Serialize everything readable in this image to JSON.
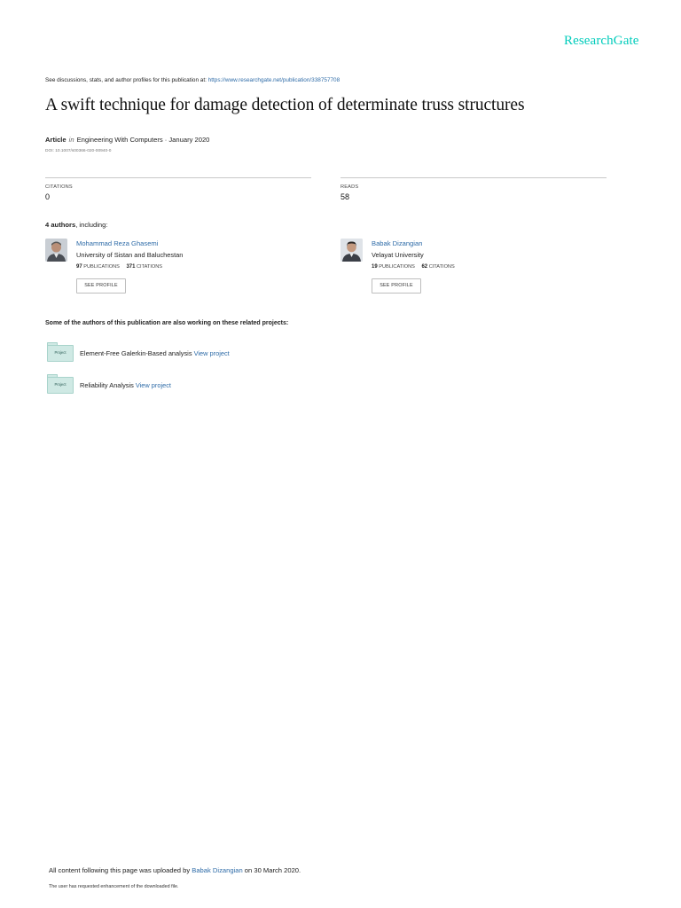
{
  "header": {
    "logo": "ResearchGate"
  },
  "discussion": {
    "prefix": "See discussions, stats, and author profiles for this publication at: ",
    "url": "https://www.researchgate.net/publication/338757708"
  },
  "publication": {
    "title": "A swift technique for damage detection of determinate truss structures",
    "type": "Article",
    "in": "in",
    "venue": "Engineering With Computers · January 2020",
    "doi": "DOI: 10.1007/s00366-020-00940-0"
  },
  "stats": {
    "citations_label": "CITATIONS",
    "citations_value": "0",
    "reads_label": "READS",
    "reads_value": "58"
  },
  "authors": {
    "heading_bold": "4 authors",
    "heading_rest": ", including:",
    "list": [
      {
        "name": "Mohammad Reza Ghasemi",
        "affiliation": "University of Sistan and Baluchestan",
        "publications_count": "97",
        "publications_label": "PUBLICATIONS",
        "citations_count": "371",
        "citations_label": "CITATIONS",
        "button": "SEE PROFILE"
      },
      {
        "name": "Babak Dizangian",
        "affiliation": "Velayat University",
        "publications_count": "19",
        "publications_label": "PUBLICATIONS",
        "citations_count": "62",
        "citations_label": "CITATIONS",
        "button": "SEE PROFILE"
      }
    ]
  },
  "related": {
    "heading": "Some of the authors of this publication are also working on these related projects:",
    "projects": [
      {
        "icon_label": "Project",
        "name": "Element-Free Galerkin-Based analysis",
        "link": "View project"
      },
      {
        "icon_label": "Project",
        "name": "Reliability Analysis",
        "link": "View project"
      }
    ]
  },
  "footer": {
    "upload_prefix": "All content following this page was uploaded by ",
    "uploader": "Babak Dizangian",
    "upload_suffix": " on 30 March 2020.",
    "note": "The user has requested enhancement of the downloaded file."
  },
  "colors": {
    "brand": "#00ccbb",
    "link": "#2f6ca8"
  }
}
